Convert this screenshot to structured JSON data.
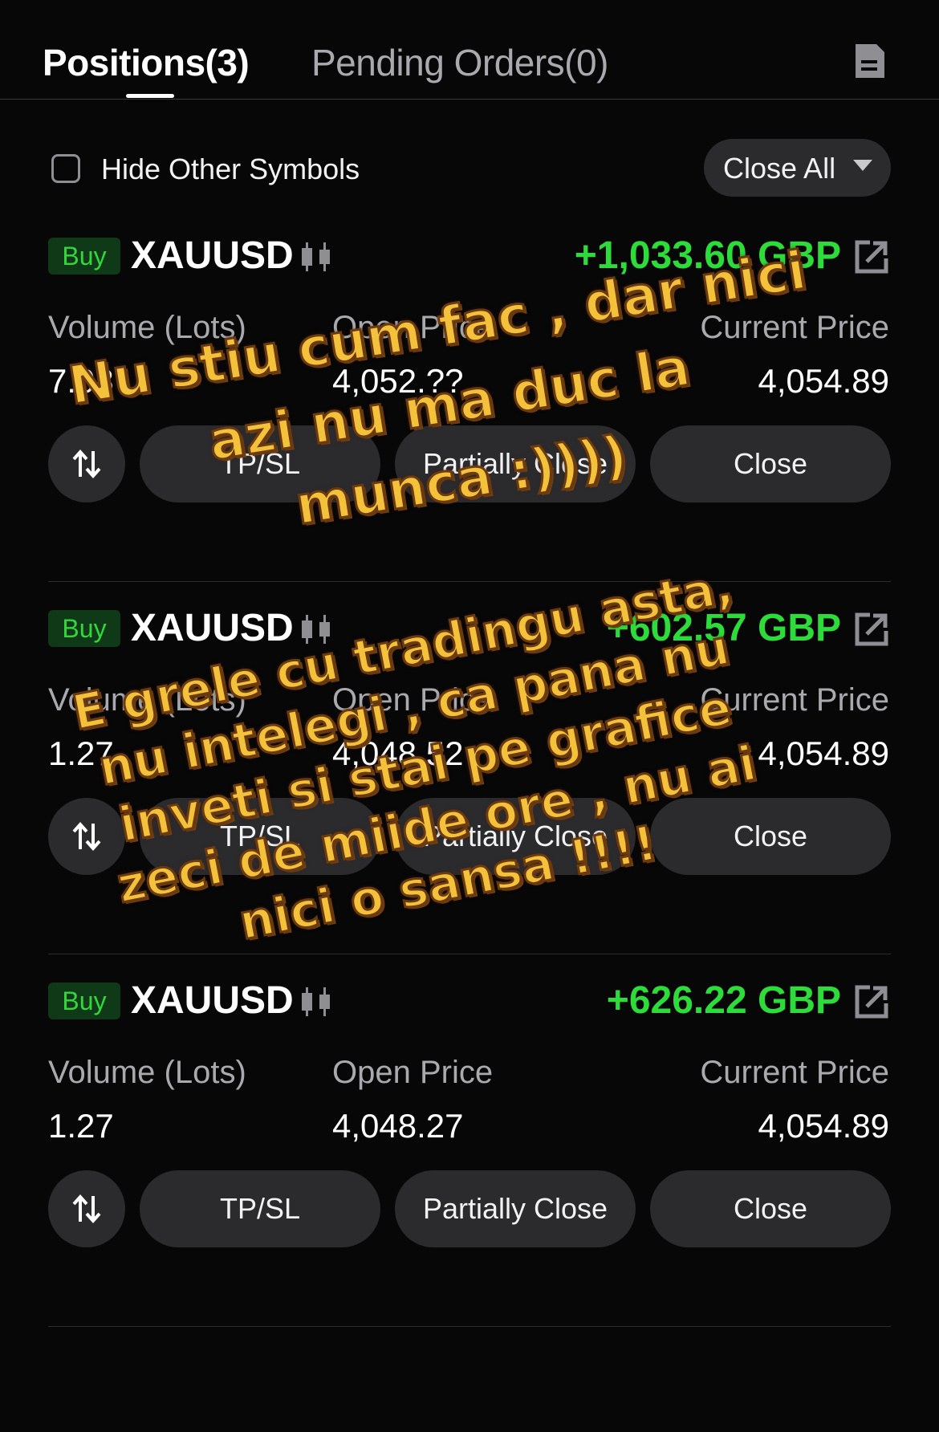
{
  "tabs": {
    "positions": "Positions(3)",
    "pending": "Pending Orders(0)",
    "doc_icon": "document-icon"
  },
  "filter": {
    "hide_other_symbols": "Hide Other Symbols",
    "hide_checked": false,
    "close_all": "Close All"
  },
  "colors": {
    "profit": "#2ddb3a",
    "buy_badge_bg": "#103a17",
    "buy_badge_text": "#35d63d",
    "overlay_text": "#f3c13a"
  },
  "positions": [
    {
      "side": "Buy",
      "symbol": "XAUUSD",
      "profit": "+1,033.60 GBP",
      "volume_label": "Volume (Lots)",
      "volume": "7.08",
      "open_label": "Open Price",
      "open_price": "4,052.??",
      "current_label": "Current Price",
      "current_price": "4,054.89",
      "tpsl": "TP/SL",
      "partial": "Partially Close",
      "close": "Close"
    },
    {
      "side": "Buy",
      "symbol": "XAUUSD",
      "profit": "+602.57 GBP",
      "volume_label": "Volume (Lots)",
      "volume": "1.27",
      "open_label": "Open Price",
      "open_price": "4,048.52",
      "current_label": "Current Price",
      "current_price": "4,054.89",
      "tpsl": "TP/SL",
      "partial": "Partially Close",
      "close": "Close"
    },
    {
      "side": "Buy",
      "symbol": "XAUUSD",
      "profit": "+626.22 GBP",
      "volume_label": "Volume (Lots)",
      "volume": "1.27",
      "open_label": "Open Price",
      "open_price": "4,048.27",
      "current_label": "Current Price",
      "current_price": "4,054.89",
      "tpsl": "TP/SL",
      "partial": "Partially Close",
      "close": "Close"
    }
  ],
  "overlay": {
    "caption1": [
      "Nu stiu cum fac , dar nici",
      "azi nu ma duc la",
      "munca :))))"
    ],
    "caption2": [
      "E grele cu tradingu asta,",
      "nu intelegi , ca pana nu",
      "inveti si stai pe grafice",
      "zeci de miide ore , nu ai",
      "nici o sansa !!!!"
    ]
  }
}
